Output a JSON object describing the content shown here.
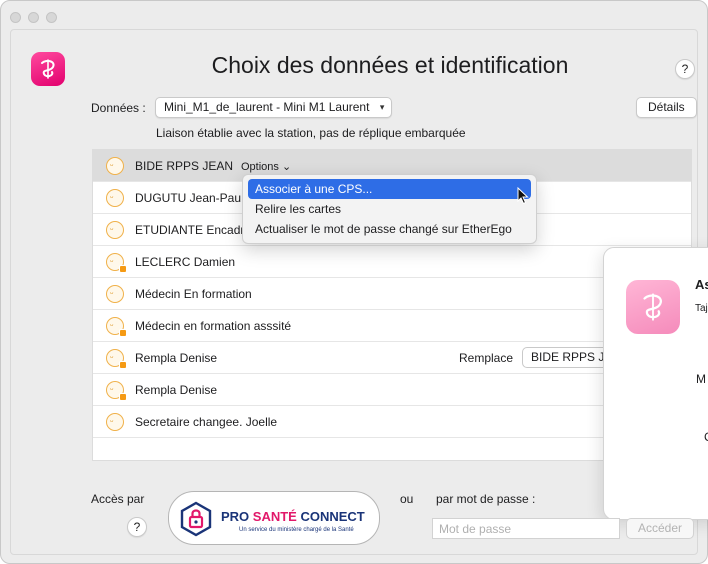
{
  "window": {
    "title": "Choix des données et identification"
  },
  "colors": {
    "brand": "#e2006e",
    "accent": "#2e6de6",
    "psc_navy": "#1a3478",
    "psc_pink": "#e2186a"
  },
  "header": {
    "help_label": "?"
  },
  "data_row": {
    "label": "Données :",
    "selected": "Mini_M1_de_laurent - Mini M1 Laurent",
    "details_label": "Détails"
  },
  "status": "Liaison établie avec la station, pas de réplique embarquée",
  "users": [
    {
      "name": "BIDE RPPS JEAN",
      "options_label": "Options",
      "selected": true,
      "locked": false
    },
    {
      "name": "DUGUTU Jean-Pau",
      "locked": false
    },
    {
      "name": "ETUDIANTE Encadr",
      "locked": false
    },
    {
      "name": "LECLERC Damien",
      "locked": true
    },
    {
      "name": "Médecin En formation",
      "locked": false
    },
    {
      "name": "Médecin en formation  asssité",
      "locked": true
    },
    {
      "name": "Rempla Denise",
      "locked": true,
      "replace_label": "Remplace",
      "replace_value": "BIDE RPPS JI"
    },
    {
      "name": "Rempla Denise",
      "locked": true
    },
    {
      "name": "Secretaire changee. Joelle",
      "locked": false
    }
  ],
  "menu": {
    "items": [
      {
        "label": "Associer à une CPS..."
      },
      {
        "label": "Relire les cartes"
      },
      {
        "label": "Actualiser le mot de passe changé sur EtherEgo"
      }
    ],
    "highlighted_index": 0
  },
  "side_panel": {
    "title_partial": "As",
    "subtitle_partial": "Taj",
    "label_m": "M",
    "label_c": "C"
  },
  "footer": {
    "acces_label": "Accès par",
    "help_label": "?",
    "psc_title_a": "PRO ",
    "psc_title_b": "SANTÉ",
    "psc_title_c": " CONNECT",
    "psc_subtitle": "Un service du ministère chargé de la Santé",
    "ou_label": "ou",
    "mdp_label": "par mot de passe :",
    "mdp_placeholder": "Mot de passe",
    "acceder_label": "Accéder"
  }
}
